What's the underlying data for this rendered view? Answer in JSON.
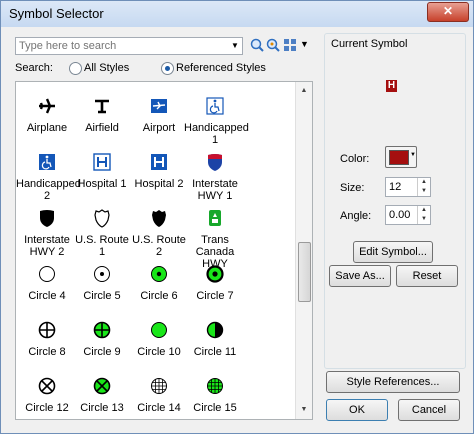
{
  "window": {
    "title": "Symbol Selector",
    "close_glyph": "✕"
  },
  "search": {
    "placeholder": "Type here to search",
    "label": "Search:",
    "all_styles": "All Styles",
    "referenced_styles": "Referenced Styles"
  },
  "symbols": [
    {
      "label": "Airplane",
      "icon": "airplane-icon"
    },
    {
      "label": "Airfield",
      "icon": "airfield-icon"
    },
    {
      "label": "Airport",
      "icon": "airport-icon"
    },
    {
      "label": "Handicapped 1",
      "icon": "handicapped-icon"
    },
    {
      "label": "Handicapped 2",
      "icon": "handicapped-icon"
    },
    {
      "label": "Hospital 1",
      "icon": "hospital-icon"
    },
    {
      "label": "Hospital 2",
      "icon": "hospital-icon"
    },
    {
      "label": "Interstate HWY 1",
      "icon": "interstate-shield-icon"
    },
    {
      "label": "Interstate HWY 2",
      "icon": "interstate-shield-icon"
    },
    {
      "label": "U.S. Route 1",
      "icon": "us-route-shield-icon"
    },
    {
      "label": "U.S. Route 2",
      "icon": "us-route-shield-icon"
    },
    {
      "label": "Trans Canada HWY",
      "icon": "trans-canada-icon"
    },
    {
      "label": "Circle 4",
      "icon": "circle-icon"
    },
    {
      "label": "Circle 5",
      "icon": "circle-dot-icon"
    },
    {
      "label": "Circle 6",
      "icon": "circle-filled-dot-icon"
    },
    {
      "label": "Circle 7",
      "icon": "circle-ring-dot-icon"
    },
    {
      "label": "Circle 8",
      "icon": "circle-cross-icon"
    },
    {
      "label": "Circle 9",
      "icon": "circle-cross-green-icon"
    },
    {
      "label": "Circle 10",
      "icon": "circle-green-icon"
    },
    {
      "label": "Circle 11",
      "icon": "circle-half-icon"
    },
    {
      "label": "Circle 12",
      "icon": "circle-x-icon"
    },
    {
      "label": "Circle 13",
      "icon": "circle-x-green-icon"
    },
    {
      "label": "Circle 14",
      "icon": "circle-grid-icon"
    },
    {
      "label": "Circle 15",
      "icon": "circle-grid-green-icon"
    }
  ],
  "current_symbol": {
    "heading": "Current Symbol",
    "preview_glyph": "H",
    "color_label": "Color:",
    "color_value": "#a50f0f",
    "size_label": "Size:",
    "size_value": "12",
    "angle_label": "Angle:",
    "angle_value": "0.00",
    "edit_symbol": "Edit Symbol...",
    "save_as": "Save As...",
    "reset": "Reset"
  },
  "buttons": {
    "style_references": "Style References...",
    "ok": "OK",
    "cancel": "Cancel"
  }
}
